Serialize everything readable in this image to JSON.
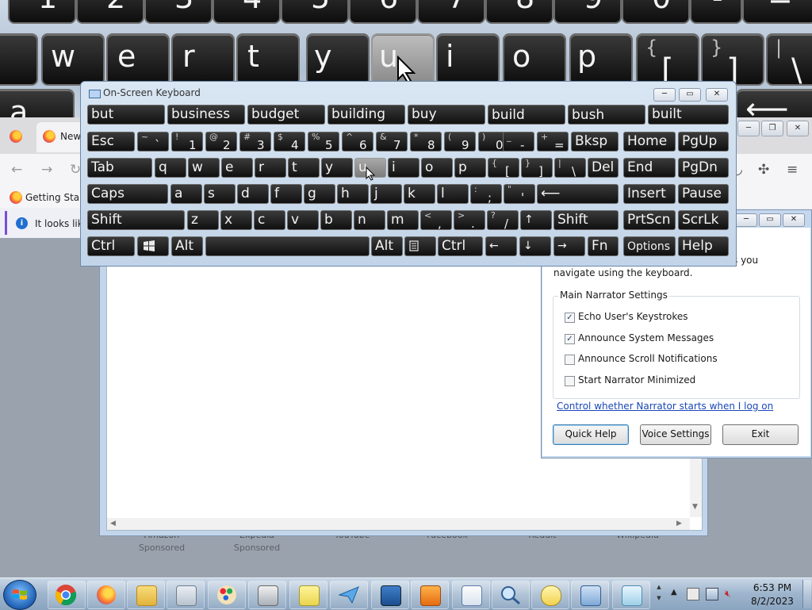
{
  "magnifier": {
    "number_row": [
      "1",
      "2",
      "3",
      "4",
      "5",
      "6",
      "7",
      "8",
      "9",
      "0",
      "-",
      "="
    ],
    "letter_row": [
      "w",
      "e",
      "r",
      "t",
      "y",
      "u",
      "i",
      "o",
      "p",
      "[",
      "]",
      "\\"
    ],
    "letter_row_sup": [
      "{",
      "}",
      "|"
    ],
    "partial_left": "a"
  },
  "browser": {
    "tab_label": "New",
    "bookmark_label": "Getting Starte",
    "info_text": "It looks like",
    "tiles": [
      {
        "label": "Amazon",
        "sub": "Sponsored"
      },
      {
        "label": "Expedia",
        "sub": "Sponsored"
      },
      {
        "label": "YouTube",
        "sub": ""
      },
      {
        "label": "Facebook",
        "sub": ""
      },
      {
        "label": "Reddit",
        "sub": ""
      },
      {
        "label": "Wikipedia",
        "sub": ""
      }
    ]
  },
  "osk": {
    "title": "On-Screen Keyboard",
    "predictions": [
      "but",
      "business",
      "budget",
      "building",
      "buy",
      "build",
      "bush",
      "built"
    ],
    "row1": {
      "esc": "Esc",
      "keys": [
        {
          "sup": "~",
          "main": "`"
        },
        {
          "sup": "!",
          "main": "1"
        },
        {
          "sup": "@",
          "main": "2"
        },
        {
          "sup": "#",
          "main": "3"
        },
        {
          "sup": "$",
          "main": "4"
        },
        {
          "sup": "%",
          "main": "5"
        },
        {
          "sup": "^",
          "main": "6"
        },
        {
          "sup": "&",
          "main": "7"
        },
        {
          "sup": "*",
          "main": "8"
        },
        {
          "sup": "(",
          "main": "9"
        },
        {
          "sup": ")",
          "main": "0"
        },
        {
          "sup": "_",
          "main": "-"
        },
        {
          "sup": "+",
          "main": "="
        }
      ],
      "bksp": "Bksp",
      "home": "Home",
      "pgup": "PgUp"
    },
    "row2": {
      "tab": "Tab",
      "letters": [
        "q",
        "w",
        "e",
        "r",
        "t",
        "y",
        "u",
        "i",
        "o",
        "p"
      ],
      "brackets": [
        {
          "sup": "{",
          "main": "["
        },
        {
          "sup": "}",
          "main": "]"
        },
        {
          "sup": "|",
          "main": "\\"
        }
      ],
      "del": "Del",
      "end": "End",
      "pgdn": "PgDn"
    },
    "row3": {
      "caps": "Caps",
      "letters": [
        "a",
        "s",
        "d",
        "f",
        "g",
        "h",
        "j",
        "k",
        "l"
      ],
      "punct": [
        {
          "sup": ":",
          "main": ";"
        },
        {
          "sup": "\"",
          "main": "'"
        }
      ],
      "enter_glyph": "⟵",
      "insert": "Insert",
      "pause": "Pause"
    },
    "row4": {
      "shift_left": "Shift",
      "letters": [
        "z",
        "x",
        "c",
        "v",
        "b",
        "n",
        "m"
      ],
      "punct": [
        {
          "sup": "<",
          "main": ","
        },
        {
          "sup": ">",
          "main": "."
        },
        {
          "sup": "?",
          "main": "/"
        }
      ],
      "up_arrow": "↑",
      "shift_right": "Shift",
      "prtscn": "PrtScn",
      "scrlk": "ScrLk"
    },
    "row5": {
      "ctrl_left": "Ctrl",
      "alt_left": "Alt",
      "alt_right": "Alt",
      "ctrl_right": "Ctrl",
      "left_arrow": "←",
      "down_arrow": "↓",
      "right_arrow": "→",
      "fn": "Fn",
      "options": "Options",
      "help": "Help"
    }
  },
  "narrator": {
    "desc_line1": "s you",
    "desc_line2": "navigate using the keyboard.",
    "group_title": "Main Narrator Settings",
    "options": [
      {
        "label": "Echo User's Keystrokes",
        "checked": true,
        "mark": "✓"
      },
      {
        "label": "Announce System Messages",
        "checked": true,
        "mark": "✓"
      },
      {
        "label": "Announce Scroll Notifications",
        "checked": false,
        "mark": ""
      },
      {
        "label": "Start Narrator Minimized",
        "checked": false,
        "mark": ""
      }
    ],
    "link": "Control whether Narrator starts when I log on",
    "quick_help": "Quick Help",
    "voice_settings": "Voice Settings",
    "exit": "Exit"
  },
  "taskbar": {
    "time": "6:53 PM",
    "date": "8/2/2023",
    "apps": [
      "chrome",
      "firefox",
      "file-explorer",
      "calculator",
      "paint",
      "fax",
      "sticky-notes",
      "paper-plane",
      "remote-desktop",
      "media",
      "wordpad",
      "magnifier",
      "narrator-speech",
      "on-screen-keyboard",
      "notepad"
    ]
  },
  "colors": {
    "key_bg": "#1a1a1a",
    "key_highlight": "#9a9a9a",
    "osk_frame": "#c9daec",
    "link": "#1a47b8",
    "taskbar": "#9db4cc"
  }
}
